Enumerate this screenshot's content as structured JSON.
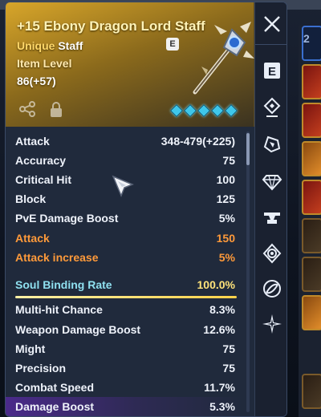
{
  "item": {
    "name": "+15 Ebony Dragon Lord Staff",
    "rarity": "Unique",
    "type": "Staff",
    "level_label": "Item Level",
    "level_value": "86(+57)",
    "badge": "E",
    "gem_count": 5
  },
  "side_buttons": [
    {
      "name": "close-icon",
      "glyph": "✕"
    },
    {
      "name": "e-tab-icon",
      "glyph": "E"
    },
    {
      "name": "enchant-icon",
      "glyph": "⟐"
    },
    {
      "name": "transform-icon",
      "glyph": "⬡"
    },
    {
      "name": "gem-icon",
      "glyph": "◇"
    },
    {
      "name": "anvil-icon",
      "glyph": "⚒"
    },
    {
      "name": "soul-icon",
      "glyph": "◈"
    },
    {
      "name": "link-icon",
      "glyph": "⊘"
    },
    {
      "name": "star-icon",
      "glyph": "✦"
    }
  ],
  "stats": [
    {
      "label": "Attack",
      "value": "348-479(+225)",
      "style": "normal"
    },
    {
      "label": "Accuracy",
      "value": "75",
      "style": "normal"
    },
    {
      "label": "Critical Hit",
      "value": "100",
      "style": "normal"
    },
    {
      "label": "Block",
      "value": "125",
      "style": "normal"
    },
    {
      "label": "PvE Damage Boost",
      "value": "5%",
      "style": "normal"
    },
    {
      "label": "Attack",
      "value": "150",
      "style": "orange"
    },
    {
      "label": "Attack increase",
      "value": "5%",
      "style": "orange"
    }
  ],
  "soul": {
    "label": "Soul Binding Rate",
    "value": "100.0%",
    "fill": 1.0
  },
  "soul_stats": [
    {
      "label": "Multi-hit Chance",
      "value": "8.3%"
    },
    {
      "label": "Weapon Damage Boost",
      "value": "12.6%"
    },
    {
      "label": "Might",
      "value": "75"
    },
    {
      "label": "Precision",
      "value": "75"
    },
    {
      "label": "Combat Speed",
      "value": "11.7%"
    },
    {
      "label": "Damage Boost",
      "value": "5.3%"
    }
  ],
  "inventory": {
    "count": "2"
  },
  "colors": {
    "header_gold": "#d8a62a",
    "orange_stat": "#ff9a3a",
    "soul_label": "#8fe0f0",
    "soul_value": "#ffe37a",
    "gem": "#3fc7ea"
  }
}
